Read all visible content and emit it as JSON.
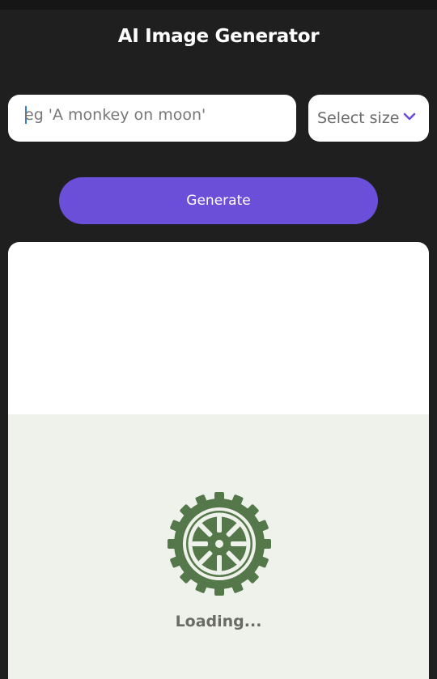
{
  "header": {
    "title": "AI Image Generator"
  },
  "prompt": {
    "placeholder": "eg 'A monkey on moon'",
    "value": ""
  },
  "size_select": {
    "label": "Select size",
    "icon": "chevron-down-icon"
  },
  "actions": {
    "generate_label": "Generate"
  },
  "result": {
    "loading_label": "Loading...",
    "icon": "wheel-icon"
  },
  "colors": {
    "background": "#1f1f1f",
    "accent": "#6c4fd8",
    "loader_green": "#55784a",
    "loader_bg": "#eff2ea"
  }
}
